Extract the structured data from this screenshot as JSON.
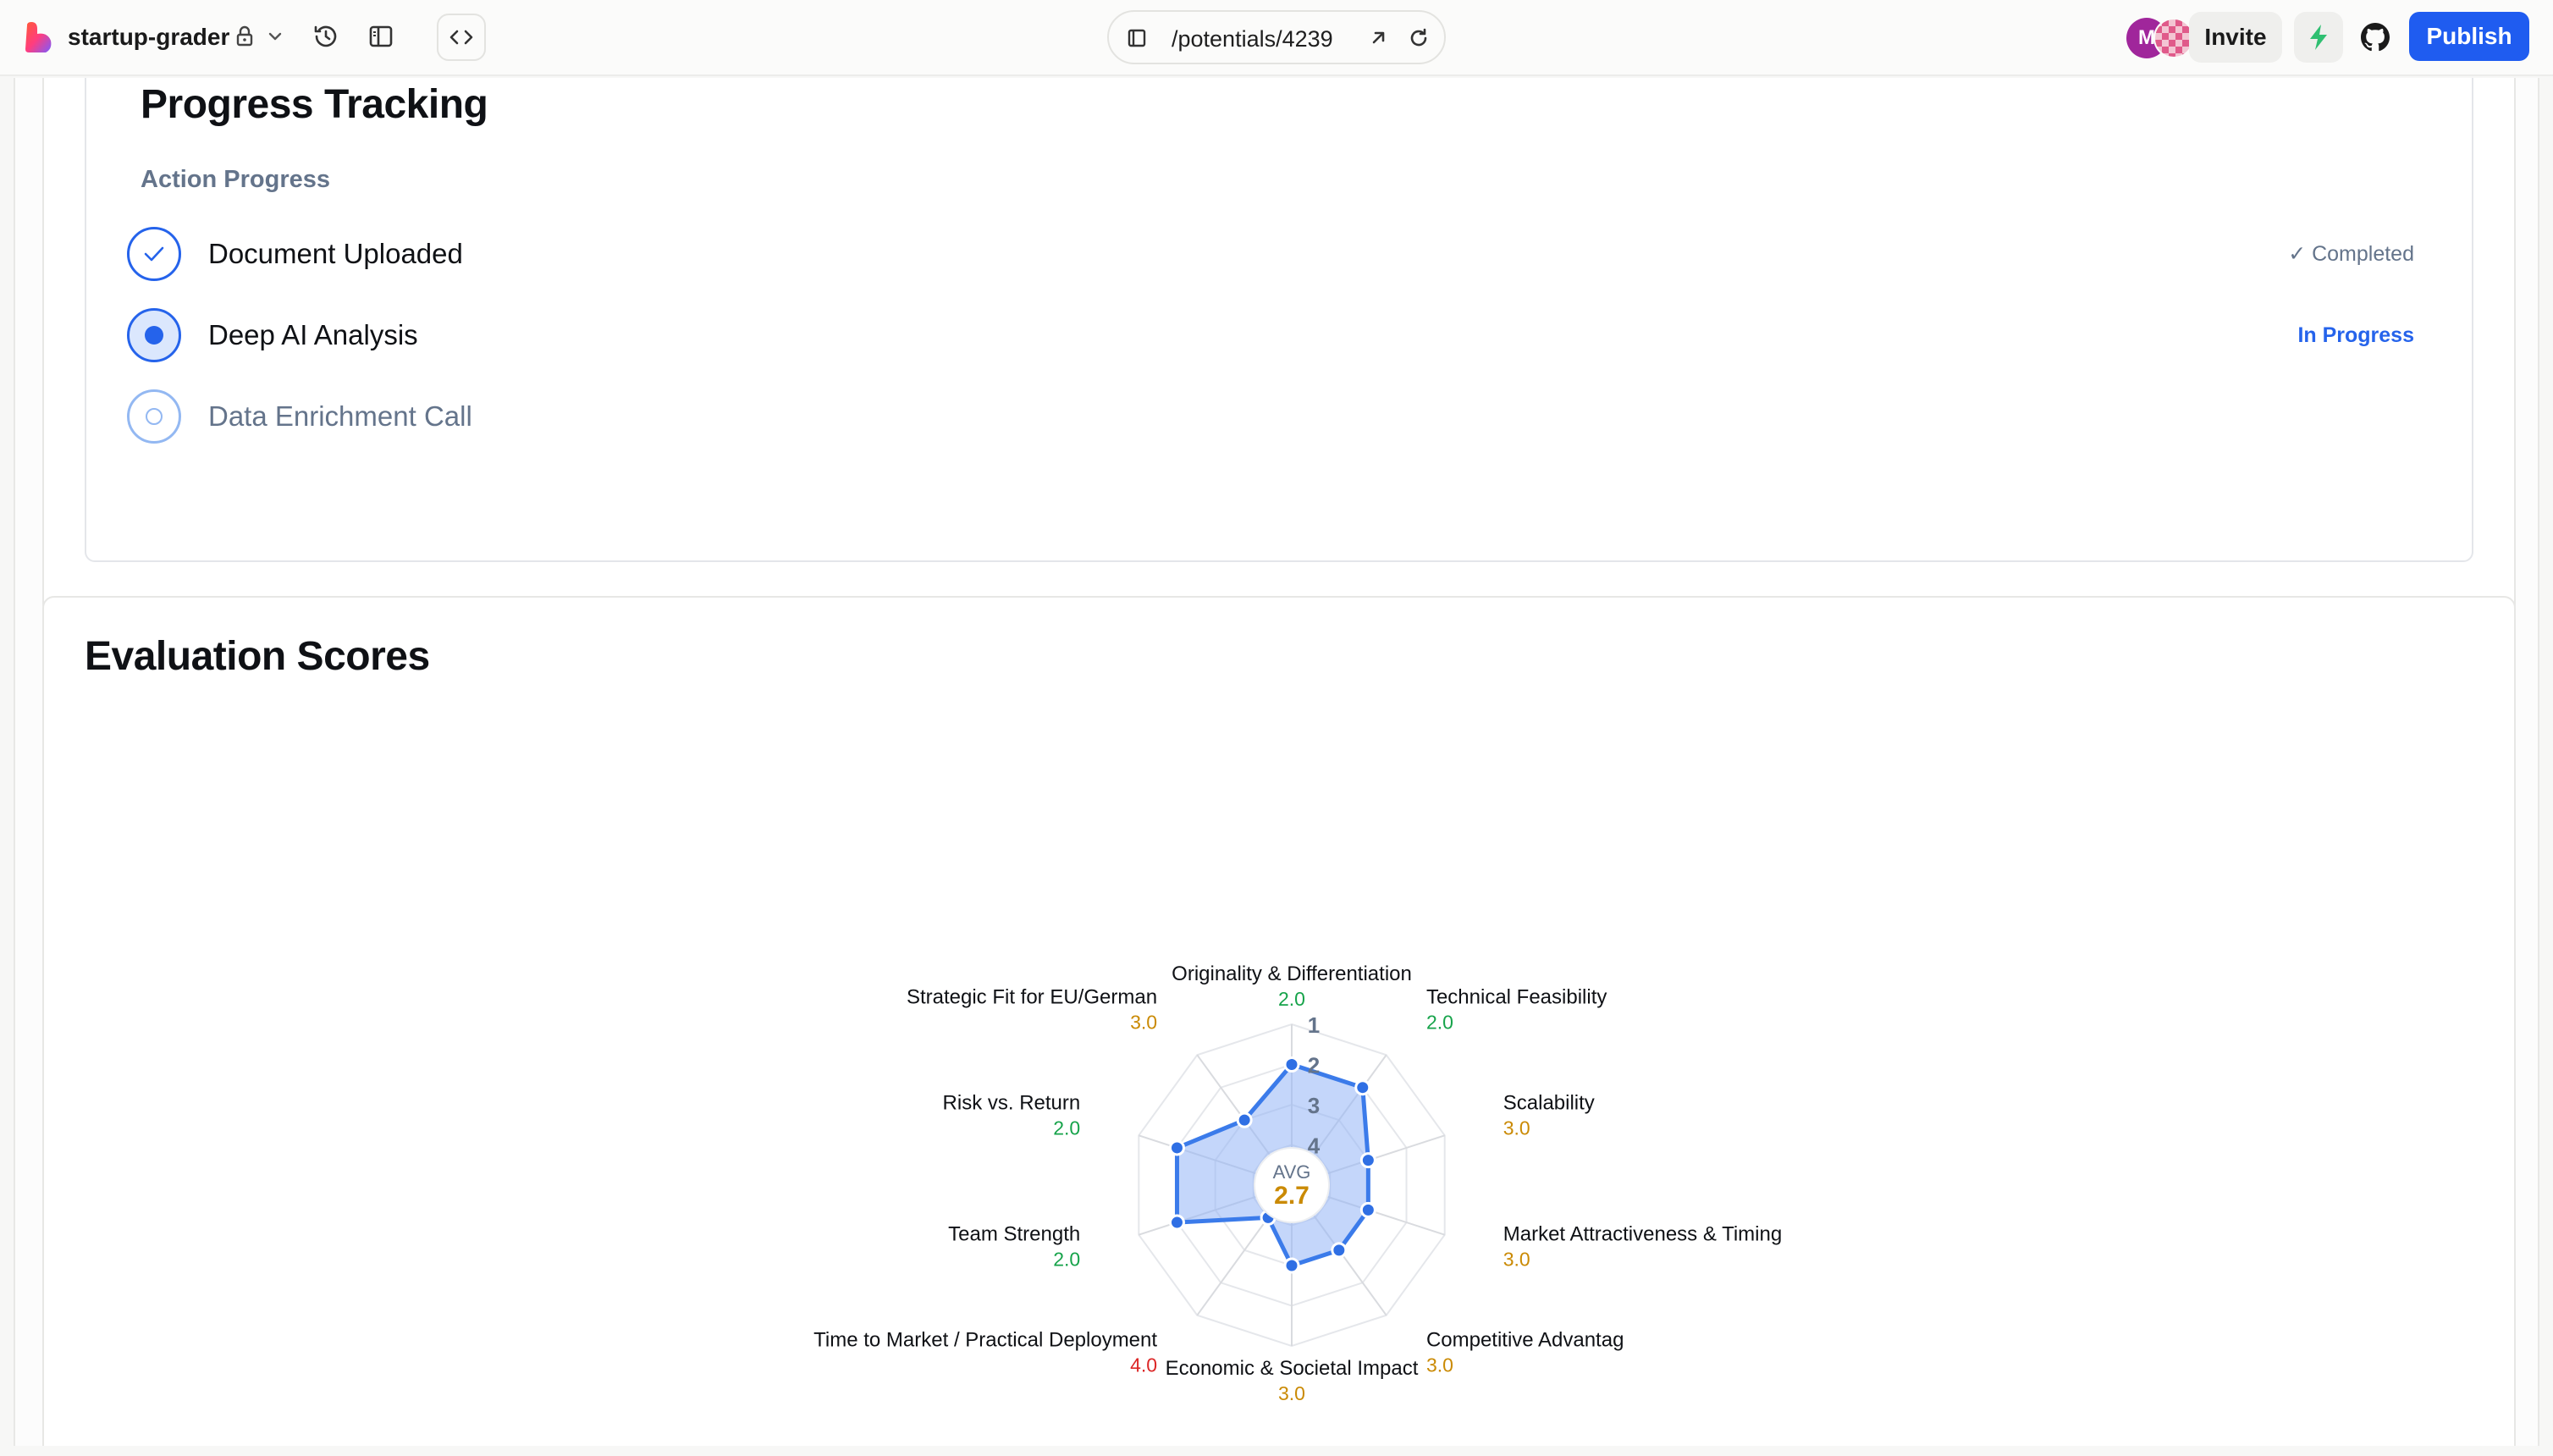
{
  "topbar": {
    "project_name": "startup-grader",
    "url": "/potentials/4239",
    "invite_label": "Invite",
    "publish_label": "Publish",
    "avatar_initial": "M",
    "icons": [
      "app-logo",
      "lock-icon",
      "chevron-down-icon",
      "history-icon",
      "sidebar-toggle-icon",
      "code-icon",
      "page-icon",
      "external-link-icon",
      "refresh-icon",
      "bolt-icon",
      "github-icon"
    ],
    "colors": {
      "publish": "#1f5cf0",
      "avatar": "#a0269b",
      "bolt": "#2fbf71"
    }
  },
  "progress": {
    "title": "Progress Tracking",
    "section_label": "Action Progress",
    "steps": [
      {
        "label": "Document Uploaded",
        "status": "✓ Completed",
        "state": "completed"
      },
      {
        "label": "Deep AI Analysis",
        "status": "In Progress",
        "state": "in-progress"
      },
      {
        "label": "Data Enrichment Call",
        "status": "",
        "state": "pending"
      }
    ]
  },
  "evaluation": {
    "title": "Evaluation Scores"
  },
  "chart_data": {
    "type": "radar",
    "center_label": "AVG",
    "center_value": "2.7",
    "ring_labels": [
      "1",
      "2",
      "3",
      "4",
      "5"
    ],
    "scale_note": "lower score plotted further from center; 1 outermost, 5 at center",
    "rmin": 1,
    "rmax": 5,
    "categories": [
      {
        "name": "Originality & Differentiation",
        "score": 2.0,
        "display": "2.0"
      },
      {
        "name": "Technical Feasibility",
        "score": 2.0,
        "display": "2.0"
      },
      {
        "name": "Scalability",
        "score": 3.0,
        "display": "3.0"
      },
      {
        "name": "Market Attractiveness & Timing",
        "score": 3.0,
        "display": "3.0"
      },
      {
        "name": "Competitive Advantag",
        "score": 3.0,
        "display": "3.0"
      },
      {
        "name": "Economic & Societal Impact",
        "score": 3.0,
        "display": "3.0"
      },
      {
        "name": "Time to Market / Practical Deployment",
        "score": 4.0,
        "display": "4.0"
      },
      {
        "name": "Team Strength",
        "score": 2.0,
        "display": "2.0"
      },
      {
        "name": "Risk vs. Return",
        "score": 2.0,
        "display": "2.0"
      },
      {
        "name": "Strategic Fit for EU/German",
        "score": 3.0,
        "display": "3.0"
      }
    ],
    "score_colors": {
      "2.0": "#16a34a",
      "3.0": "#ca8a04",
      "4.0": "#dc2626"
    },
    "fill_color": "#93b4f5",
    "stroke_color": "#3b7bea"
  }
}
